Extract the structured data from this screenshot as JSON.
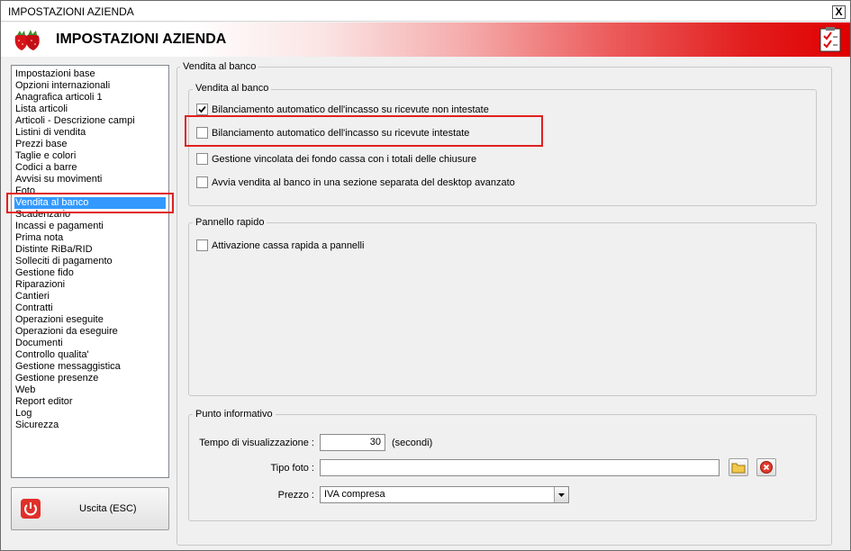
{
  "window": {
    "title": "IMPOSTAZIONI AZIENDA",
    "close_label": "X"
  },
  "header": {
    "title": "IMPOSTAZIONI AZIENDA",
    "logo_icon": "strawberries-icon",
    "action_icon": "checklist-icon"
  },
  "sidebar": {
    "items": [
      "Impostazioni base",
      "Opzioni internazionali",
      "Anagrafica articoli 1",
      "Lista articoli",
      "Articoli - Descrizione campi",
      "Listini di vendita",
      "Prezzi base",
      "Taglie e colori",
      "Codici a barre",
      "Avvisi su movimenti",
      "Foto",
      "Vendita al banco",
      "Scadenzario",
      "Incassi e pagamenti",
      "Prima nota",
      "Distinte RiBa/RID",
      "Solleciti di pagamento",
      "Gestione fido",
      "Riparazioni",
      "Cantieri",
      "Contratti",
      "Operazioni eseguite",
      "Operazioni da eseguire",
      "Documenti",
      "Controllo qualita'",
      "Gestione messaggistica",
      "Gestione presenze",
      "Web",
      "Report editor",
      "Log",
      "Sicurezza"
    ],
    "selected": "Vendita al banco",
    "selection_color": "#3399ff"
  },
  "exit_button": {
    "label": "Uscita (ESC)",
    "icon": "power-icon"
  },
  "main": {
    "outer_group": "Vendita al banco",
    "vendita_group": {
      "label": "Vendita al banco",
      "options": [
        {
          "label": "Bilanciamento automatico dell'incasso su ricevute non intestate",
          "checked": true
        },
        {
          "label": "Bilanciamento automatico dell'incasso su ricevute intestate",
          "checked": false
        },
        {
          "label": "Gestione vincolata dei fondo cassa con i totali delle chiusure",
          "checked": false
        },
        {
          "label": "Avvia vendita al banco in una sezione separata del desktop avanzato",
          "checked": false
        }
      ]
    },
    "pannello_group": {
      "label": "Pannello rapido",
      "options": [
        {
          "label": "Attivazione cassa rapida a pannelli",
          "checked": false
        }
      ]
    },
    "punto_group": {
      "label": "Punto informativo",
      "tempo_label": "Tempo di visualizzazione :",
      "tempo_value": "30",
      "tempo_unit": "(secondi)",
      "foto_label": "Tipo foto :",
      "foto_value": "",
      "prezzo_label": "Prezzo :",
      "prezzo_value": "IVA compresa"
    }
  },
  "colors": {
    "highlight": "#e02020",
    "header_gradient_end": "#e00000"
  }
}
